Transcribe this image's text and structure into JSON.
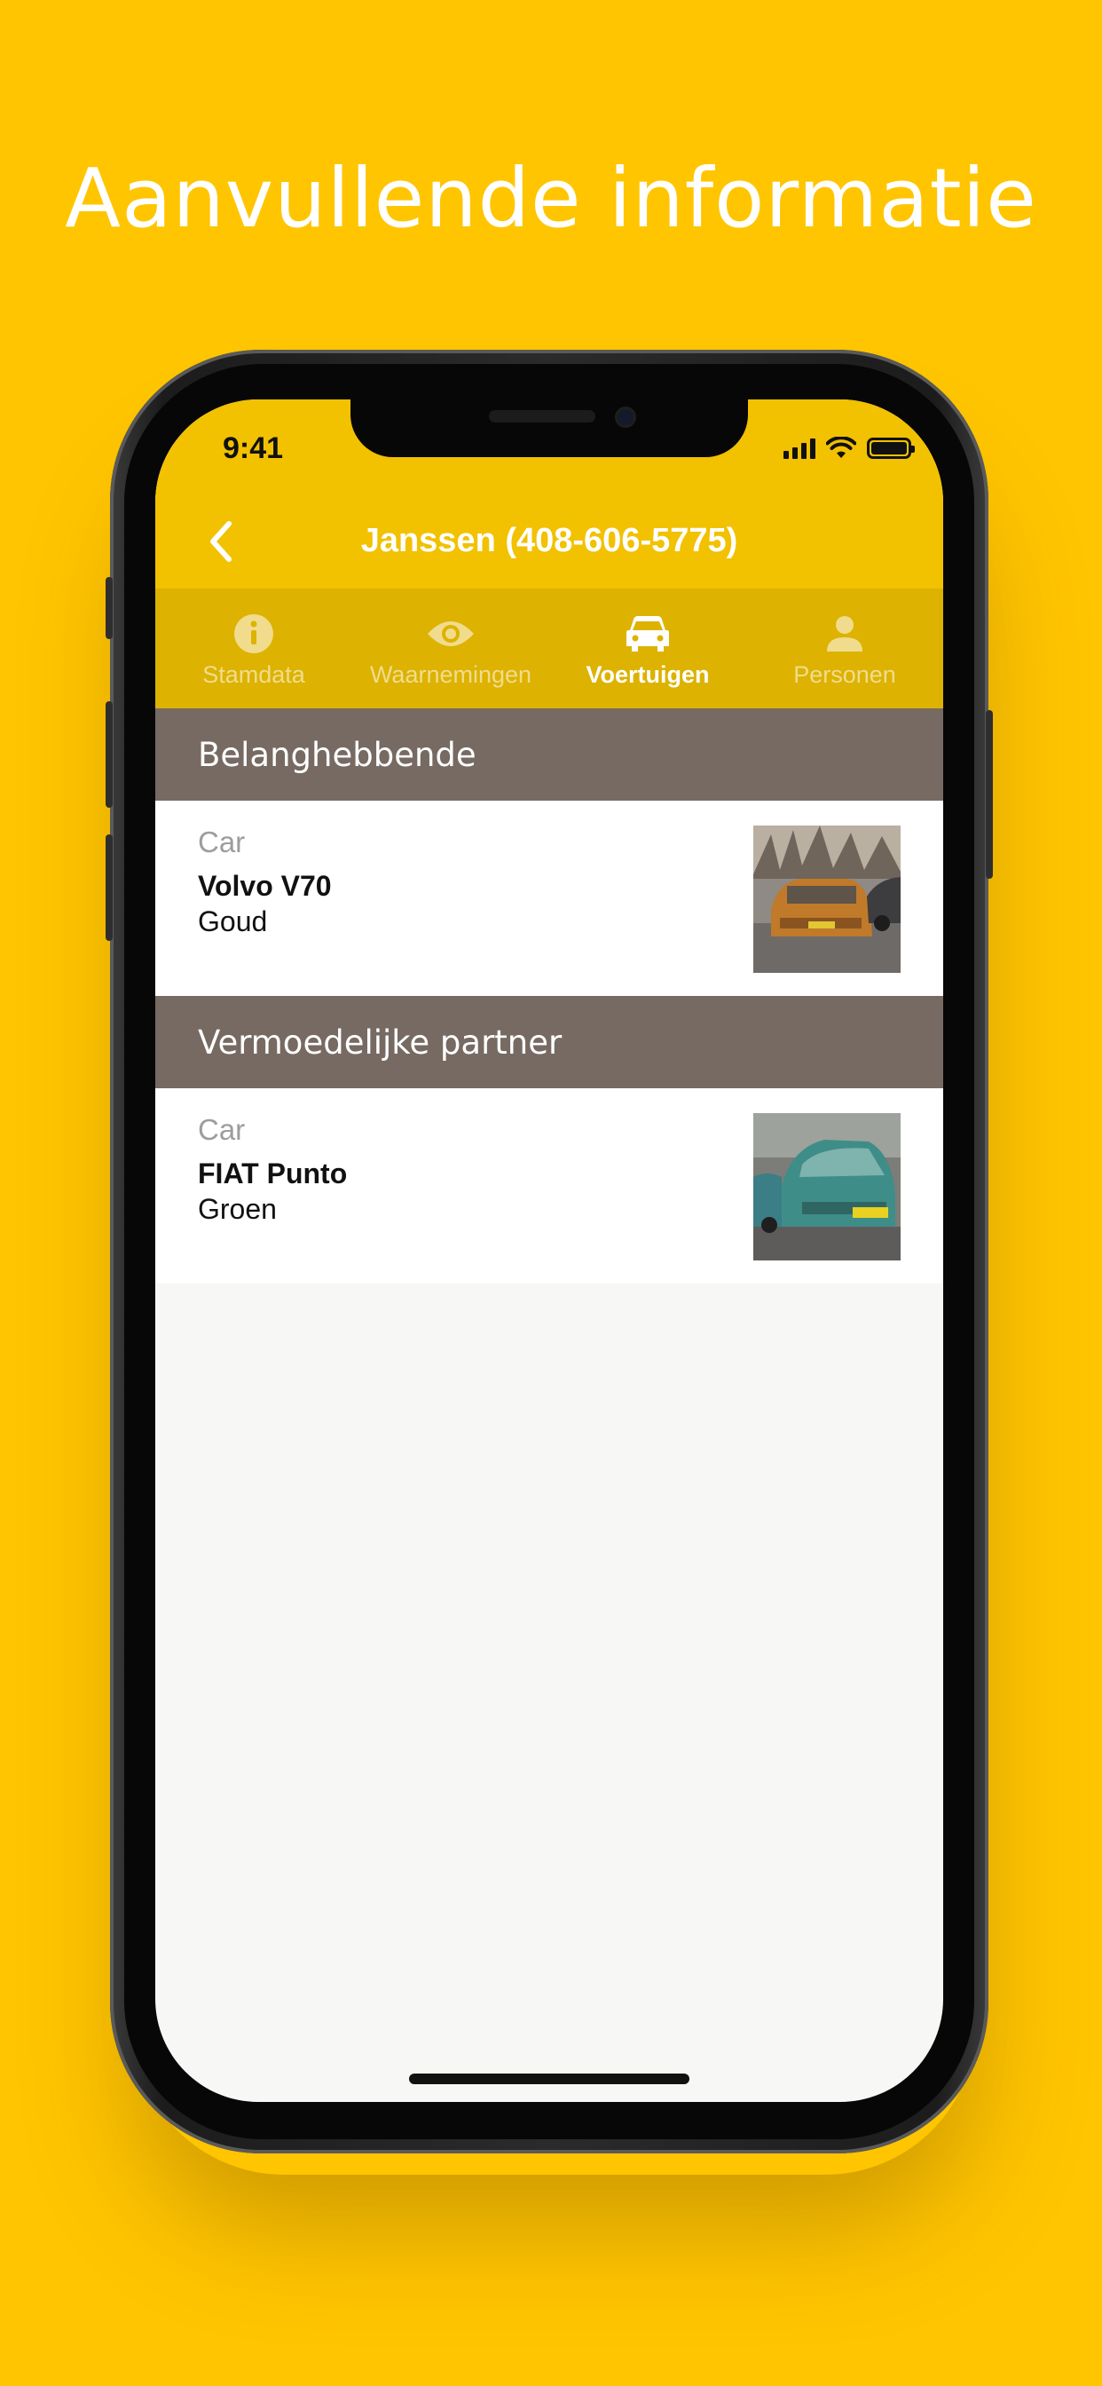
{
  "promo": {
    "title": "Aanvullende informatie"
  },
  "status_bar": {
    "time": "9:41"
  },
  "nav": {
    "title": "Janssen (408-606-5775)",
    "back_icon": "chevron-left-icon"
  },
  "tabs": [
    {
      "label": "Stamdata",
      "icon": "info-icon",
      "active": false
    },
    {
      "label": "Waarnemingen",
      "icon": "eye-icon",
      "active": false
    },
    {
      "label": "Voertuigen",
      "icon": "car-icon",
      "active": true
    },
    {
      "label": "Personen",
      "icon": "person-icon",
      "active": false
    }
  ],
  "sections": [
    {
      "header": "Belanghebbende",
      "vehicle": {
        "type": "Car",
        "name": "Volvo V70",
        "color": "Goud"
      }
    },
    {
      "header": "Vermoedelijke partner",
      "vehicle": {
        "type": "Car",
        "name": "FIAT Punto",
        "color": "Groen"
      }
    }
  ],
  "colors": {
    "background": "#FFC500",
    "header": "#F2C100",
    "tab_bar": "#DDB200",
    "section_header": "#766A62"
  }
}
